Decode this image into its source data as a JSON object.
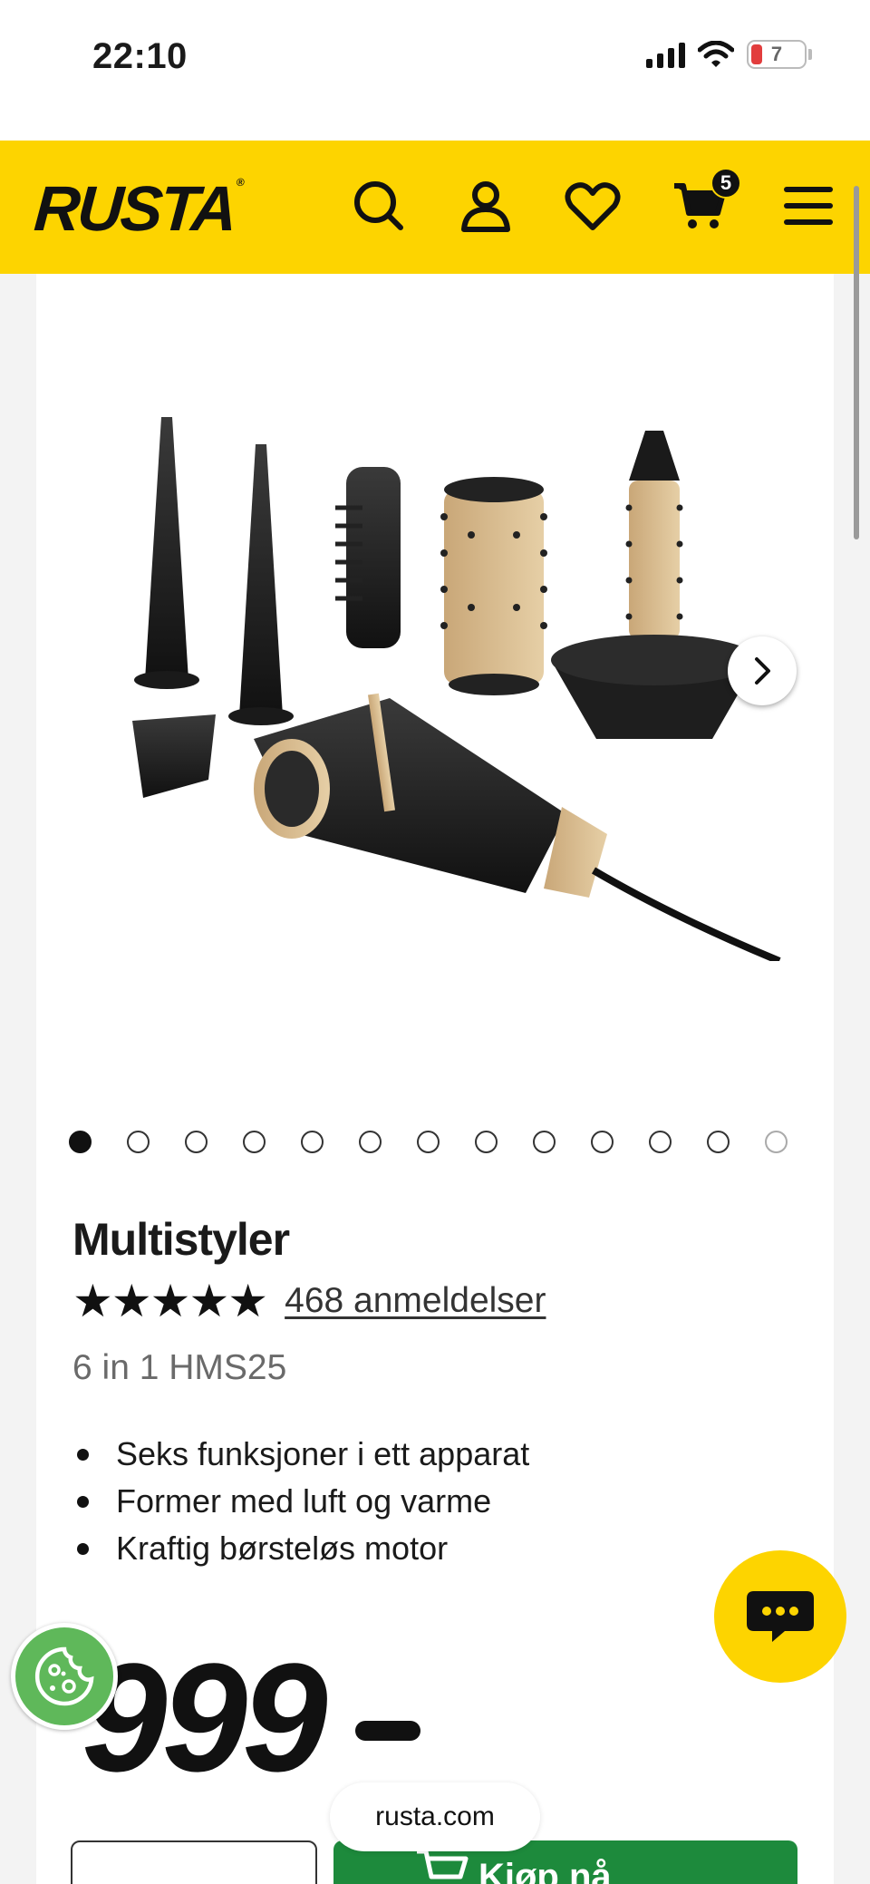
{
  "status_bar": {
    "time": "22:10",
    "battery_level": "7"
  },
  "header": {
    "logo": "RUSTA",
    "cart_count": "5",
    "brand_color": "#fdd400"
  },
  "gallery": {
    "image_count": 13,
    "active_index": 0
  },
  "product": {
    "title": "Multistyler",
    "stars": "★★★★★",
    "rating": 4.8,
    "reviews": "468 anmeldelser",
    "model": "6 in 1 HMS25",
    "features": [
      "Seks funksjoner i ett apparat",
      "Former med luft og varme",
      "Kraftig børsteløs motor"
    ],
    "price": "999"
  },
  "actions": {
    "buy_label": "Kjøp nå"
  },
  "browser": {
    "url": "rusta.com"
  },
  "colors": {
    "accent": "#fdd400",
    "buy": "#1d8a3c",
    "cookie": "#5fb85a"
  }
}
